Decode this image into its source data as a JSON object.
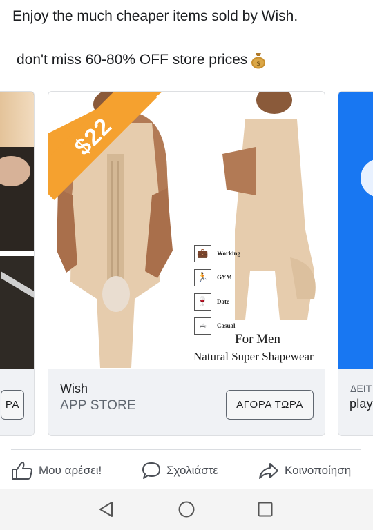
{
  "post": {
    "line1": "Enjoy the much cheaper items sold by Wish.",
    "line2": "don't miss 60-80% OFF store prices",
    "line2_emoji": "money-bag-icon"
  },
  "carousel": {
    "cards": [
      {
        "title": "",
        "subtitle": "",
        "cta": "ΡΑ"
      },
      {
        "price_badge": "$22",
        "product_features": [
          "Working",
          "GYM",
          "Date",
          "Casual"
        ],
        "product_caption_1": "For Men",
        "product_caption_2": "Natural Super Shapewear",
        "title": "Wish",
        "subtitle": "APP STORE",
        "cta": "ΑΓΟΡΑ ΤΩΡΑ"
      },
      {
        "title": "ΔΕΙΤ",
        "subtitle": "play",
        "cta": ""
      }
    ]
  },
  "actions": {
    "like": "Μου αρέσει!",
    "comment": "Σχολιάστε",
    "share": "Κοινοποίηση"
  },
  "colors": {
    "price_badge": "#f5a12f",
    "right_card_bg": "#1877f2",
    "footer_bg": "#f0f2f5"
  }
}
